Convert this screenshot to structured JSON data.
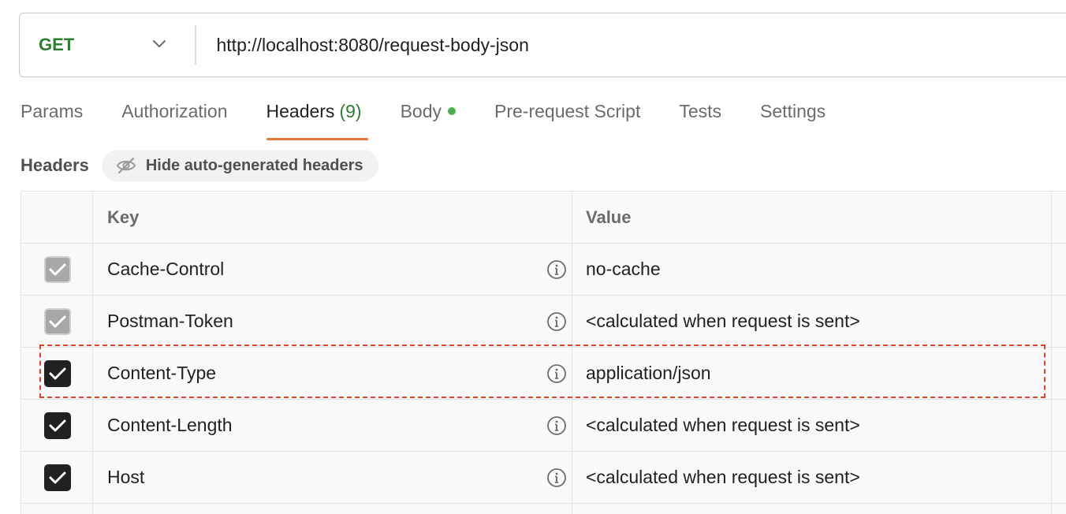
{
  "request": {
    "method": "GET",
    "url": "http://localhost:8080/request-body-json"
  },
  "tabs": [
    {
      "label": "Params"
    },
    {
      "label": "Authorization"
    },
    {
      "label": "Headers",
      "count": "(9)",
      "active": true
    },
    {
      "label": "Body",
      "indicator": "green-dot"
    },
    {
      "label": "Pre-request Script"
    },
    {
      "label": "Tests"
    },
    {
      "label": "Settings"
    }
  ],
  "headers_section": {
    "label": "Headers",
    "hide_button_label": "Hide auto-generated headers",
    "hide_button_icon": "eye-off-icon"
  },
  "table": {
    "columns": [
      "Key",
      "Value"
    ],
    "rows": [
      {
        "key": "Cache-Control",
        "value": "no-cache",
        "checked": true,
        "auto_generated": true
      },
      {
        "key": "Postman-Token",
        "value": "<calculated when request is sent>",
        "checked": true,
        "auto_generated": true
      },
      {
        "key": "Content-Type",
        "value": "application/json",
        "checked": true,
        "auto_generated": false,
        "highlighted": true
      },
      {
        "key": "Content-Length",
        "value": "<calculated when request is sent>",
        "checked": true,
        "auto_generated": false
      },
      {
        "key": "Host",
        "value": "<calculated when request is sent>",
        "checked": true,
        "auto_generated": false
      }
    ]
  },
  "colors": {
    "method_get": "#2e7d32",
    "active_tab_underline": "#e8743b",
    "body_dot": "#4caf50",
    "highlight_border": "#e0452c"
  }
}
